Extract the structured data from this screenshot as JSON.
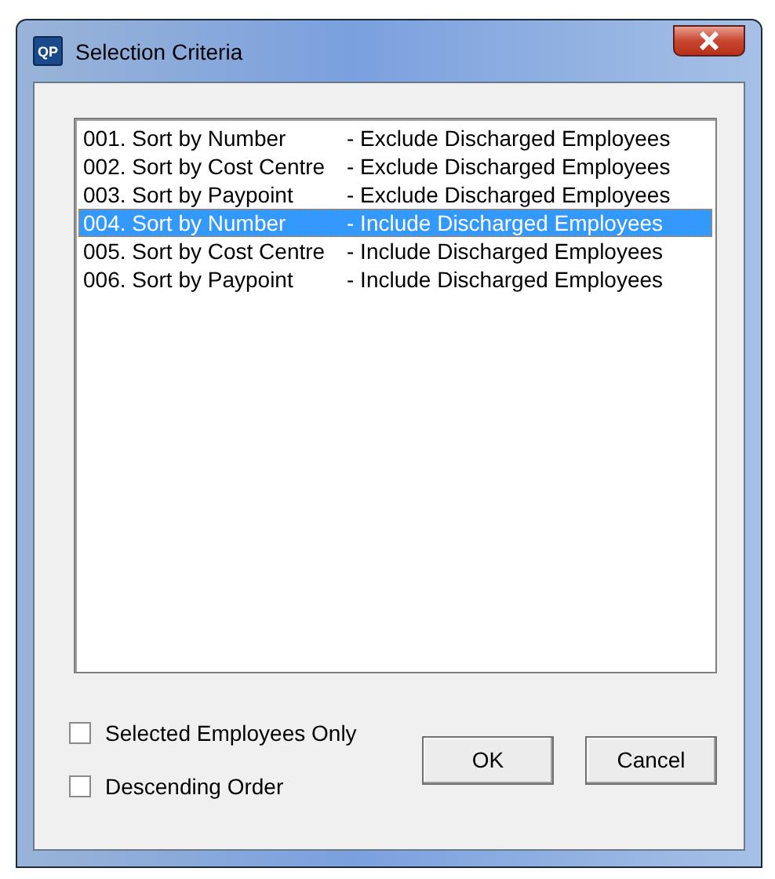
{
  "window": {
    "title": "Selection Criteria",
    "icon_text": "QP"
  },
  "list": {
    "items": [
      {
        "sort": "001. Sort by Number",
        "filter": "- Exclude Discharged Employees",
        "selected": false
      },
      {
        "sort": "002. Sort by Cost Centre",
        "filter": "- Exclude Discharged Employees",
        "selected": false
      },
      {
        "sort": "003. Sort by Paypoint",
        "filter": "- Exclude Discharged Employees",
        "selected": false
      },
      {
        "sort": "004. Sort by Number",
        "filter": "- Include Discharged Employees",
        "selected": true
      },
      {
        "sort": "005. Sort by Cost Centre",
        "filter": "- Include Discharged Employees",
        "selected": false
      },
      {
        "sort": "006. Sort by Paypoint",
        "filter": "- Include Discharged Employees",
        "selected": false
      }
    ]
  },
  "options": [
    {
      "label": "Selected Employees Only",
      "checked": false
    },
    {
      "label": "Descending Order",
      "checked": false
    }
  ],
  "buttons": [
    "OK",
    "Cancel"
  ]
}
